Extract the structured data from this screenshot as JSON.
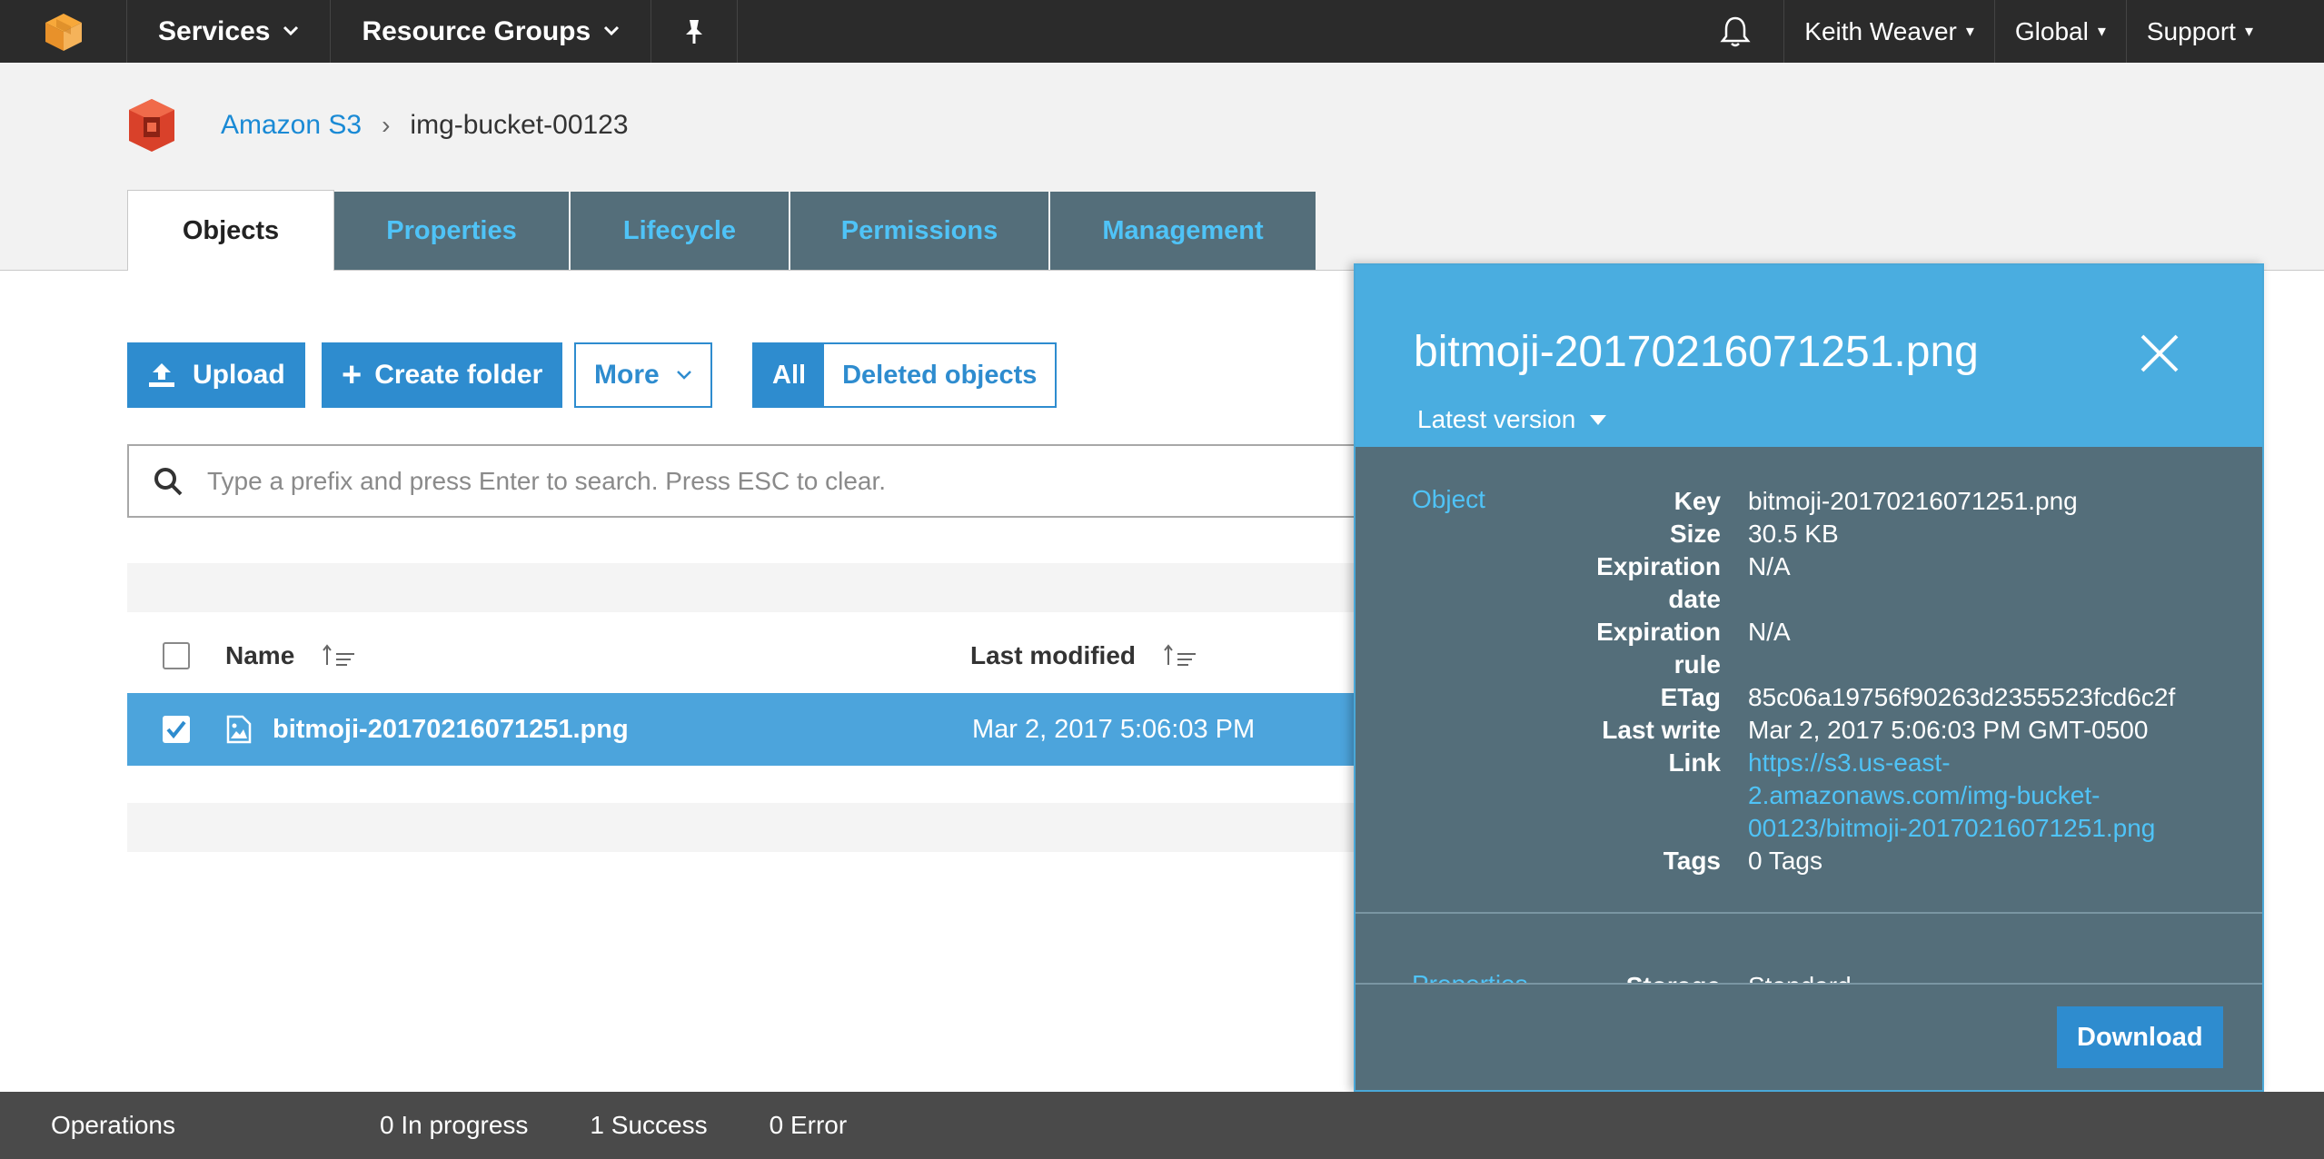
{
  "nav": {
    "services": "Services",
    "resource_groups": "Resource Groups",
    "user": "Keith Weaver",
    "region": "Global",
    "support": "Support"
  },
  "breadcrumb": {
    "root": "Amazon S3",
    "current": "img-bucket-00123"
  },
  "tabs": [
    "Objects",
    "Properties",
    "Lifecycle",
    "Permissions",
    "Management"
  ],
  "toolbar": {
    "upload": "Upload",
    "create_folder": "Create folder",
    "more": "More",
    "all": "All",
    "deleted_objects": "Deleted objects"
  },
  "search": {
    "placeholder": "Type a prefix and press Enter to search. Press ESC to clear."
  },
  "table": {
    "headers": [
      "Name",
      "Last modified"
    ],
    "rows": [
      {
        "name": "bitmoji-20170216071251.png",
        "last_modified": "Mar 2, 2017 5:06:03 PM",
        "selected": true
      }
    ]
  },
  "panel": {
    "title": "bitmoji-20170216071251.png",
    "version": "Latest version",
    "section_object": "Object",
    "fields": {
      "key_label": "Key",
      "key": "bitmoji-20170216071251.png",
      "size_label": "Size",
      "size": "30.5 KB",
      "exp_date_label_1": "Expiration",
      "exp_date_label_2": "date",
      "exp_date": "N/A",
      "exp_rule_label_1": "Expiration",
      "exp_rule_label_2": "rule",
      "exp_rule": "N/A",
      "etag_label": "ETag",
      "etag": "85c06a19756f90263d2355523fcd6c2f",
      "last_write_label": "Last write",
      "last_write": "Mar 2, 2017 5:06:03 PM GMT-0500",
      "link_label": "Link",
      "link_1": "https://s3.us-east-",
      "link_2": "2.amazonaws.com/img-bucket-",
      "link_3": "00123/bitmoji-20170216071251.png",
      "tags_label": "Tags",
      "tags": "0 Tags"
    },
    "section_properties": "Properties",
    "storage_label": "Storage",
    "storage_value": "Standard",
    "download": "Download"
  },
  "status": {
    "operations": "Operations",
    "in_progress": "0 In progress",
    "success": "1 Success",
    "error": "0 Error"
  },
  "colors": {
    "nav_bg": "#2b2b2b",
    "accent": "#2e8ccf",
    "tab_bg": "#546e7a",
    "panel_head": "#4aade0",
    "selected_row": "#4ca4dc"
  }
}
